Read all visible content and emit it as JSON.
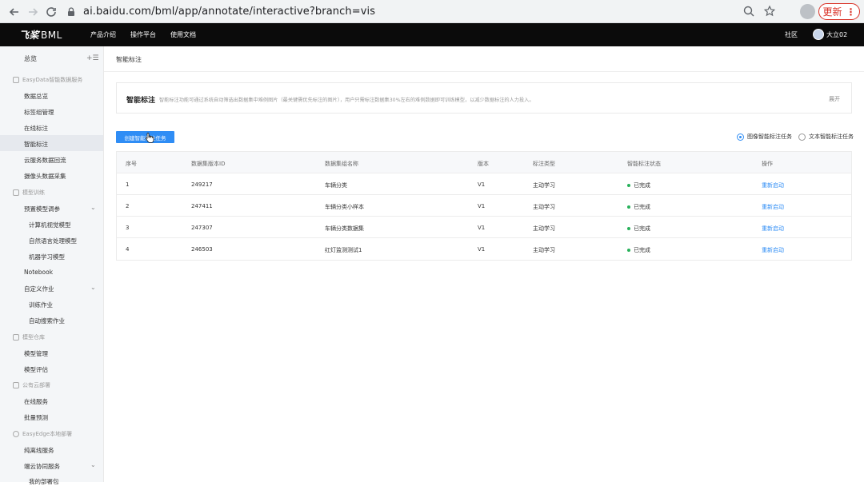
{
  "browser": {
    "url": "ai.baidu.com/bml/app/annotate/interactive?branch=vis",
    "update_label": "更新"
  },
  "topnav": {
    "logo_prefix": "飞桨",
    "logo_suffix": "BML",
    "items": [
      "产品介绍",
      "操作平台",
      "使用文档"
    ],
    "community": "社区",
    "user": "大立02"
  },
  "sidebar": {
    "overview": "总览",
    "sections": [
      {
        "title": "EasyData智能数据服务"
      },
      {
        "title": "模型训练"
      },
      {
        "title": "模型仓库"
      },
      {
        "title": "公有云部署"
      },
      {
        "title": "EasyEdge本地部署"
      }
    ],
    "items": {
      "data_overview": "数据总览",
      "label_group": "标签组管理",
      "online_annotate": "在线标注",
      "smart_annotate": "智能标注",
      "cloud_reflow": "云服务数据回流",
      "camera_collect": "摄像头数据采集",
      "preset_tuning": "预置模型调参",
      "cv_model": "计算机视觉模型",
      "nlp_model": "自然语言处理模型",
      "ml_model": "机器学习模型",
      "notebook": "Notebook",
      "custom_job": "自定义作业",
      "train_job": "训练作业",
      "auto_search": "自动搜索作业",
      "model_manage": "模型管理",
      "model_eval": "模型评估",
      "online_service": "在线服务",
      "batch_predict": "批量预测",
      "offline_service": "纯离线服务",
      "edge_cloud": "端云协同服务",
      "my_deploy": "我的部署包"
    }
  },
  "main": {
    "breadcrumb": "智能标注",
    "info_title": "智能标注",
    "info_desc": "智能标注功能可通过系统自动筛选出数据集中难例图片（最关键需优先标注的图片），用户只需标注数据集30%左右的难例数据即可训练模型，以减少数据标注的人力投入。",
    "info_expand": "展开",
    "create_button": "创建智能标注任务",
    "radio_image": "图像智能标注任务",
    "radio_text": "文本智能标注任务",
    "table": {
      "headers": [
        "序号",
        "数据集版本ID",
        "数据集组名称",
        "版本",
        "标注类型",
        "智能标注状态",
        "操作"
      ],
      "rows": [
        [
          "1",
          "249217",
          "车辆分类",
          "V1",
          "主动学习",
          "已完成",
          "重新启动"
        ],
        [
          "2",
          "247411",
          "车辆分类小样本",
          "V1",
          "主动学习",
          "已完成",
          "重新启动"
        ],
        [
          "3",
          "247307",
          "车辆分类数据集",
          "V1",
          "主动学习",
          "已完成",
          "重新启动"
        ],
        [
          "4",
          "246503",
          "红灯监测测试1",
          "V1",
          "主动学习",
          "已完成",
          "重新启动"
        ]
      ]
    }
  }
}
